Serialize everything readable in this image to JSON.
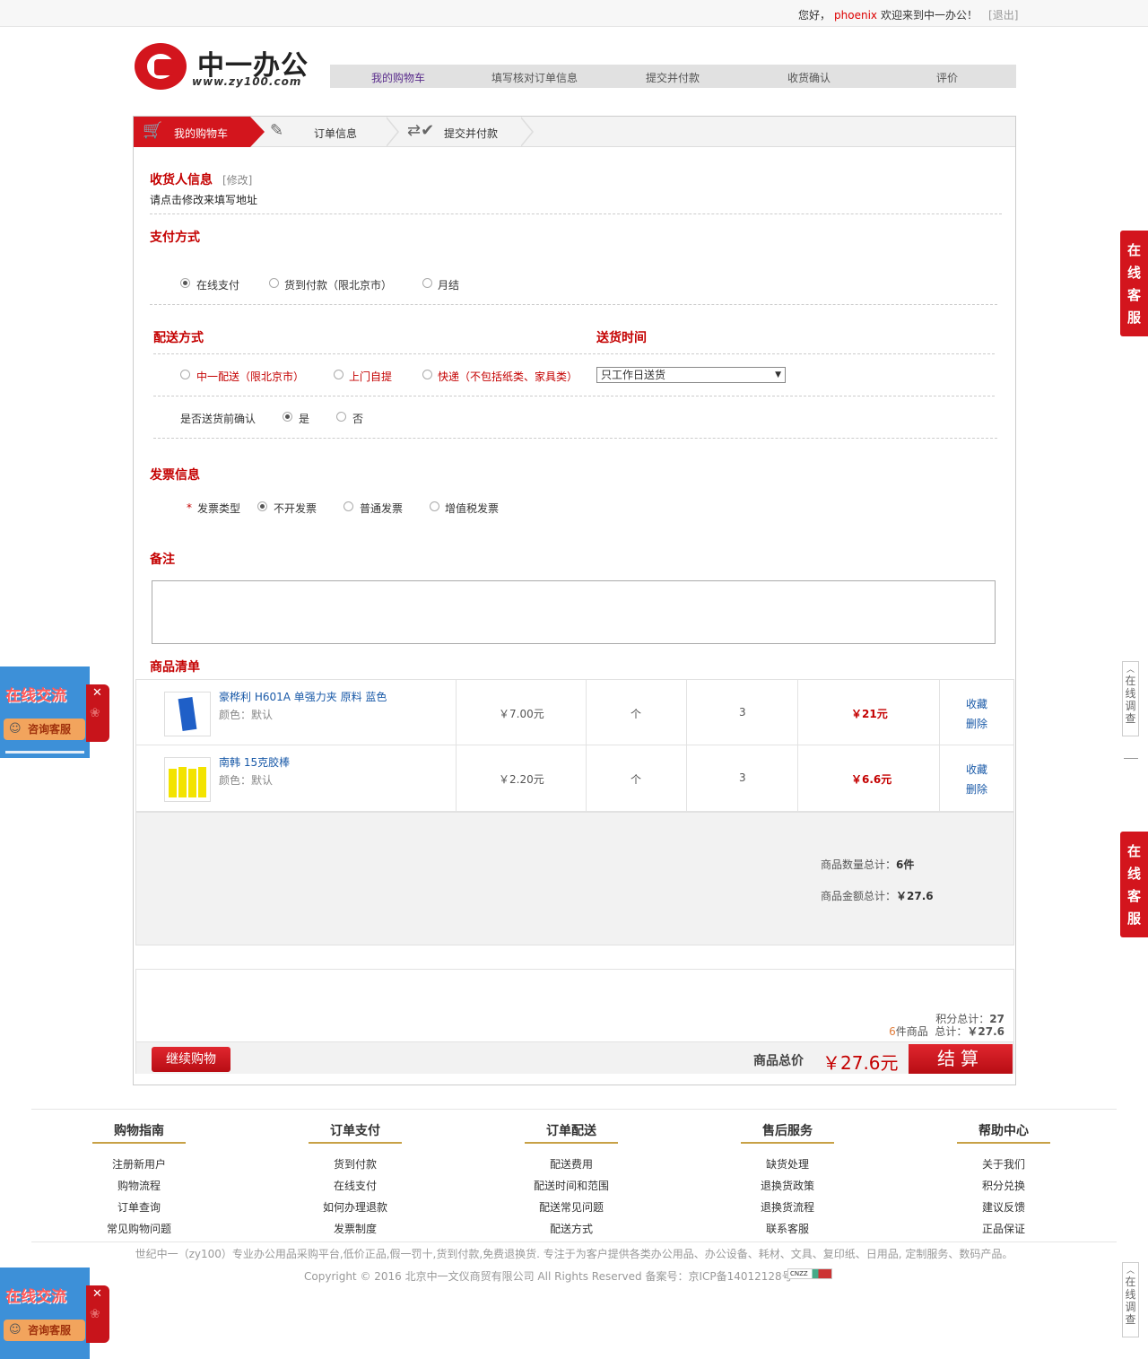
{
  "topbar": {
    "greeting": "您好，",
    "username": "phoenix",
    "welcome": "欢迎来到中一办公！",
    "logout": "[退出]"
  },
  "logo": {
    "name": "中一办公",
    "url": "www.zy100.com"
  },
  "step_nav": [
    "我的购物车",
    "填写核对订单信息",
    "提交并付款",
    "收货确认",
    "评价"
  ],
  "tabs": [
    "我的购物车",
    "订单信息",
    "提交并付款"
  ],
  "receiver": {
    "title": "收货人信息",
    "edit": "[修改]",
    "hint": "请点击修改来填写地址"
  },
  "payment": {
    "title": "支付方式",
    "options": [
      "在线支付",
      "货到付款（限北京市）",
      "月结"
    ],
    "selected": "在线支付"
  },
  "delivery": {
    "title": "配送方式",
    "time_title": "送货时间",
    "options": [
      "中一配送（限北京市）",
      "上门自提",
      "快递（不包括纸类、家具类）"
    ],
    "time_value": "只工作日送货",
    "confirm_label": "是否送货前确认",
    "confirm_options": [
      "是",
      "否"
    ],
    "confirm_selected": "是"
  },
  "invoice": {
    "title": "发票信息",
    "required_mark": "*",
    "type_label": "发票类型",
    "options": [
      "不开发票",
      "普通发票",
      "增值税发票"
    ],
    "selected": "不开发票"
  },
  "remark": {
    "title": "备注"
  },
  "products": {
    "title": "商品清单",
    "items": [
      {
        "name": "豪桦利 H601A 单强力夹 原料 蓝色",
        "attr": "颜色：默认",
        "price": "￥7.00元",
        "unit": "个",
        "qty": "3",
        "subtotal": "￥21元",
        "fav": "收藏",
        "del": "删除"
      },
      {
        "name": "南韩 15克胶棒",
        "attr": "颜色：默认",
        "price": "￥2.20元",
        "unit": "个",
        "qty": "3",
        "subtotal": "￥6.6元",
        "fav": "收藏",
        "del": "删除"
      }
    ]
  },
  "summary": {
    "count_label": "商品数量总计：",
    "count_value": "6件",
    "amount_label": "商品金额总计：",
    "amount_value": "￥27.6"
  },
  "checkout": {
    "points_label": "积分总计：",
    "points_value": "27",
    "items_count": "6",
    "items_label": "件商品",
    "total_label_small": "总计：",
    "total_small": "￥27.6",
    "continue": "继续购物",
    "total_label": "商品总价",
    "total_value": "￥27.6元",
    "pay": "结算"
  },
  "footer": {
    "columns": [
      {
        "title": "购物指南",
        "items": [
          "注册新用户",
          "购物流程",
          "订单查询",
          "常见购物问题"
        ]
      },
      {
        "title": "订单支付",
        "items": [
          "货到付款",
          "在线支付",
          "如何办理退款",
          "发票制度"
        ]
      },
      {
        "title": "订单配送",
        "items": [
          "配送费用",
          "配送时间和范围",
          "配送常见问题",
          "配送方式"
        ]
      },
      {
        "title": "售后服务",
        "items": [
          "缺货处理",
          "退换货政策",
          "退换货流程",
          "联系客服"
        ]
      },
      {
        "title": "帮助中心",
        "items": [
          "关于我们",
          "积分兑换",
          "建议反馈",
          "正品保证"
        ]
      }
    ],
    "description": "世纪中一（zy100）专业办公用品采购平台,低价正品,假一罚十,货到付款,免费退换货. 专注于为客户提供各类办公用品、办公设备、耗材、文具、复印纸、日用品, 定制服务、数码产品。",
    "copyright": "Copyright © 2016 北京中一文仪商贸有限公司 All Rights Reserved 备案号：京ICP备14012128号",
    "badge": "CNZZ"
  },
  "widgets": {
    "kefu": [
      "在",
      "线",
      "客",
      "服"
    ],
    "survey": [
      "在",
      "线",
      "调",
      "查"
    ],
    "chat_title": "在线交流",
    "chat_button": "咨询客服"
  },
  "colors": {
    "brand_red": "#d3151d",
    "link_blue": "#1a5aa8",
    "price_red": "#c40000"
  }
}
